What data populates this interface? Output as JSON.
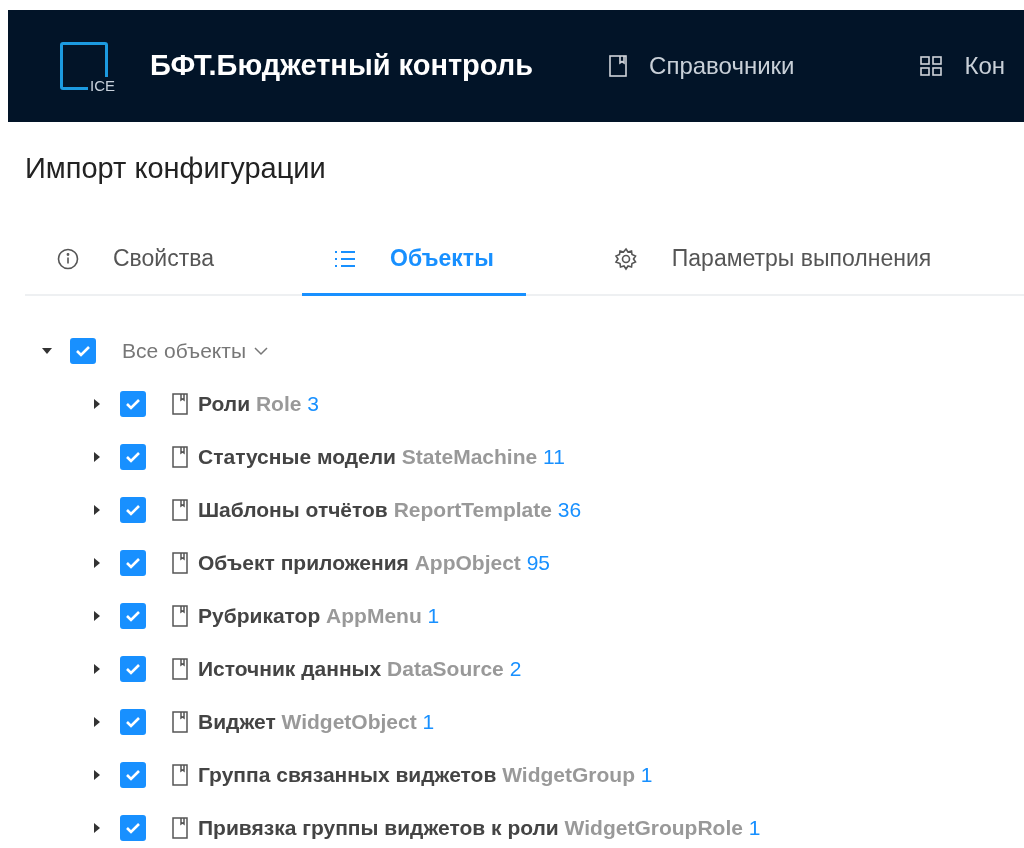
{
  "header": {
    "logo_text": "ICE",
    "title": "БФТ.Бюджетный контроль",
    "nav": [
      {
        "label": "Справочники"
      },
      {
        "label": "Кон"
      }
    ]
  },
  "page_title": "Импорт конфигурации",
  "tabs": [
    {
      "label": "Свойства",
      "selected": false
    },
    {
      "label": "Объекты",
      "selected": true
    },
    {
      "label": "Параметры выполнения",
      "selected": false
    }
  ],
  "tree": {
    "label": "Все объекты",
    "expanded": true,
    "checked": true,
    "children": [
      {
        "name": "Роли",
        "code": "Role",
        "count": "3",
        "expanded": false,
        "checked": true
      },
      {
        "name": "Статусные модели",
        "code": "StateMachine",
        "count": "11",
        "expanded": false,
        "checked": true
      },
      {
        "name": "Шаблоны отчётов",
        "code": "ReportTemplate",
        "count": "36",
        "expanded": false,
        "checked": true
      },
      {
        "name": "Объект приложения",
        "code": "AppObject",
        "count": "95",
        "expanded": false,
        "checked": true
      },
      {
        "name": "Рубрикатор",
        "code": "AppMenu",
        "count": "1",
        "expanded": false,
        "checked": true
      },
      {
        "name": "Источник данных",
        "code": "DataSource",
        "count": "2",
        "expanded": false,
        "checked": true
      },
      {
        "name": "Виджет",
        "code": "WidgetObject",
        "count": "1",
        "expanded": false,
        "checked": true
      },
      {
        "name": "Группа связанных виджетов",
        "code": "WidgetGroup",
        "count": "1",
        "expanded": false,
        "checked": true
      },
      {
        "name": "Привязка группы виджетов к роли",
        "code": "WidgetGroupRole",
        "count": "1",
        "expanded": false,
        "checked": true
      }
    ]
  }
}
